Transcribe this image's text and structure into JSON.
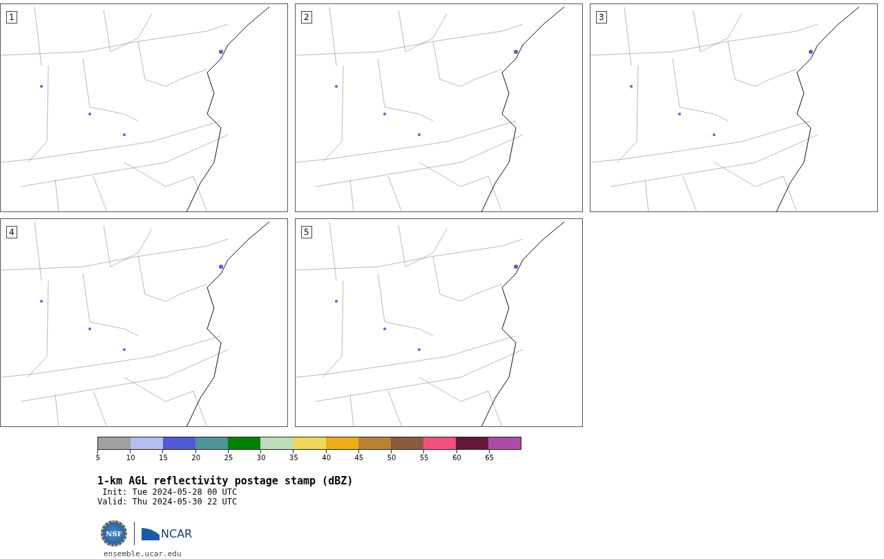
{
  "panels": [
    {
      "number": "1"
    },
    {
      "number": "2"
    },
    {
      "number": "3"
    },
    {
      "number": "4"
    },
    {
      "number": "5"
    }
  ],
  "colorbar": {
    "bins": [
      {
        "color": "#a0a0a0"
      },
      {
        "color": "#b4bef0"
      },
      {
        "color": "#505ad8"
      },
      {
        "color": "#4e9598"
      },
      {
        "color": "#008200"
      },
      {
        "color": "#bcdcbc"
      },
      {
        "color": "#eed85c"
      },
      {
        "color": "#eeac16"
      },
      {
        "color": "#bb8132"
      },
      {
        "color": "#8b5a3c"
      },
      {
        "color": "#f4507c"
      },
      {
        "color": "#621836"
      },
      {
        "color": "#ac4ca4"
      }
    ],
    "ticks": [
      "5",
      "10",
      "15",
      "20",
      "25",
      "30",
      "35",
      "40",
      "45",
      "50",
      "55",
      "60",
      "65"
    ]
  },
  "title": "1-km AGL reflectivity postage stamp (dBZ)",
  "init": " Init: Tue 2024-05-28 00 UTC",
  "valid": "Valid: Thu 2024-05-30 22 UTC",
  "logos": {
    "nsf": "NSF",
    "ncar": "NCAR"
  },
  "footer": "ensemble.ucar.edu"
}
